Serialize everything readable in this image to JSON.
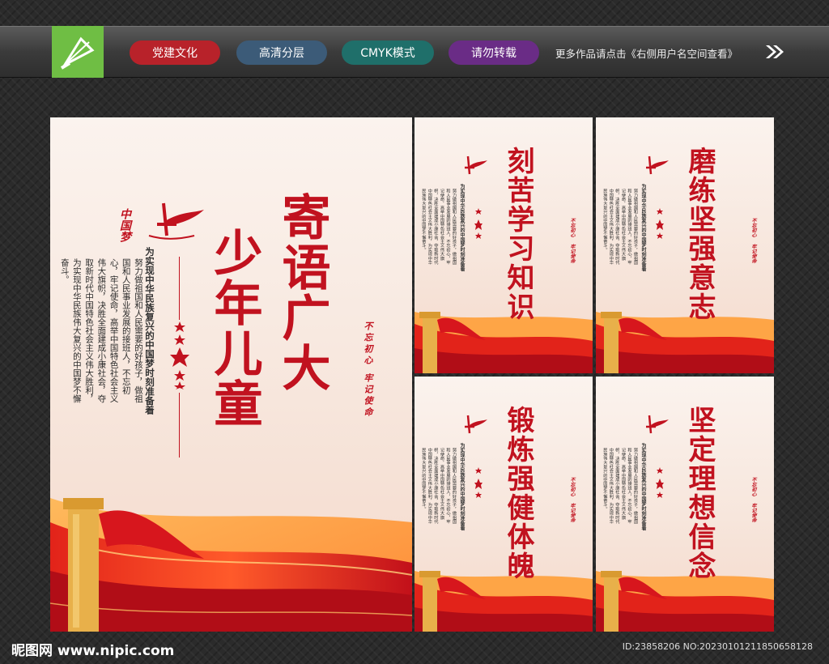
{
  "header": {
    "tags": [
      "党建文化",
      "高清分层",
      "CMYK模式",
      "请勿转载"
    ],
    "more_text": "更多作品请点击《右侧用户名空间查看》",
    "colors": {
      "tag1": "#b8222a",
      "tag2": "#3c5b78",
      "tag3": "#1f6f6a",
      "tag4": "#6a2c86",
      "logo": "#6fbe44"
    }
  },
  "main_poster": {
    "title_col1": "寄语广大",
    "title_col2": "少年儿童",
    "subtitle": "为实现中华民族复兴的中国梦时刻准备着",
    "body": "努力做祖国和人民需要的好孩子，做祖国和人民事业发展的接班人，不忘初心，牢记使命，高举中国特色社会主义伟大旗帜，决胜全面建成小康社会，夺取新时代中国特色社会主义伟大胜利，为实现中华民族伟大复兴的中国梦不懈奋斗。",
    "seal_1": "不忘初心",
    "seal_2": "牢记使命",
    "logo_text": "中国梦"
  },
  "small_posters": [
    {
      "title": "刻苦学习知识"
    },
    {
      "title": "磨练坚强意志"
    },
    {
      "title": "锻炼强健体魄"
    },
    {
      "title": "坚定理想信念"
    }
  ],
  "small_common": {
    "subtitle": "为实现中华民族复兴的中国梦时刻准备着",
    "body": "努力做祖国和人民需要的好孩子，做祖国和人民事业发展的接班人，不忘初心，牢记使命，高举中国特色社会主义伟大旗帜，决胜全面建成小康社会，夺取新时代中国特色社会主义伟大胜利，为实现中华民族伟大复兴的中国梦不懈奋斗。",
    "seal_1": "不忘初心",
    "seal_2": "牢记使命"
  },
  "footer": {
    "site": "昵图网 www.nipic.com",
    "id_text": "ID:23858206 NO:20230101211850658128"
  }
}
